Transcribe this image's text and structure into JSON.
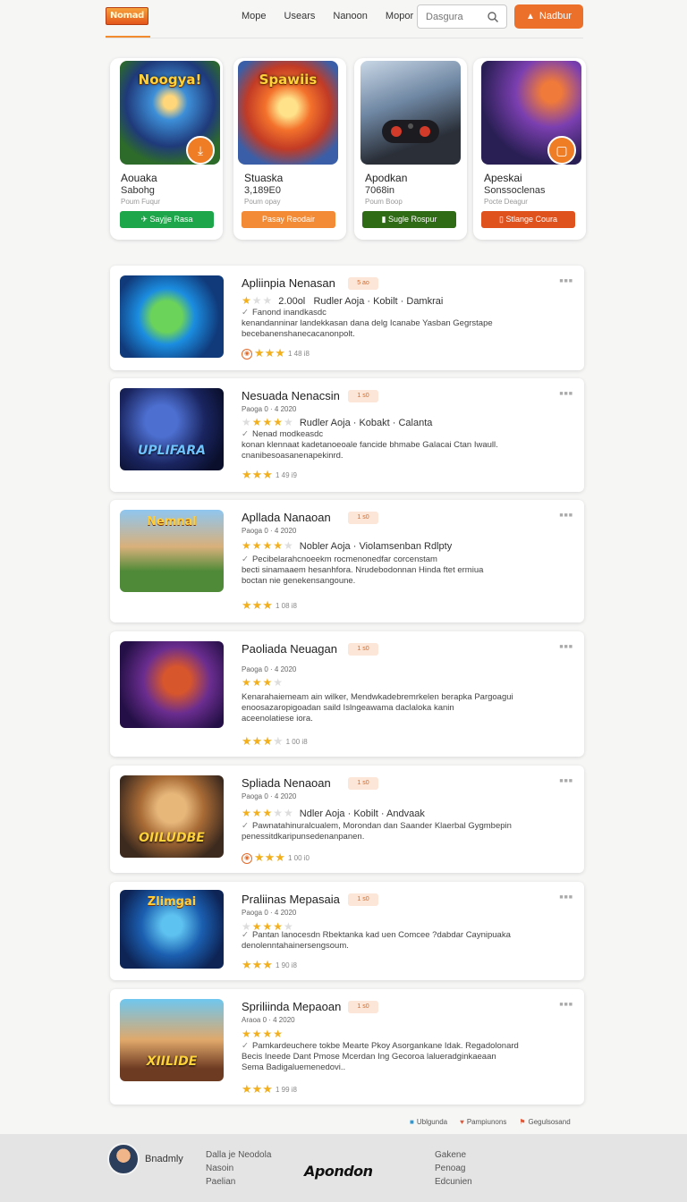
{
  "header": {
    "logo": "Nomad",
    "nav": [
      "Mope",
      "Usears",
      "Nanoon",
      "Mopor"
    ],
    "search_placeholder": "Dasgura",
    "cta_label": "Nadbur"
  },
  "featured": [
    {
      "thumb_text": "Noogya!",
      "title": "Aouaka",
      "subtitle": "Sabohg",
      "caption": "Poum Fuqur",
      "button": "Sayjje Rasa",
      "button_color": "#1ea64a"
    },
    {
      "thumb_text": "Spawiis",
      "title": "Stuaska",
      "subtitle": "3,189E0",
      "caption": "Poum opay",
      "button": "Pasay Reodair",
      "button_color": "#f28a36"
    },
    {
      "thumb_text": "",
      "title": "Apodkan",
      "subtitle": "7068in",
      "caption": "Poum Boop",
      "button": "Sugle Rospur",
      "button_color": "#2f6a14"
    },
    {
      "thumb_text": "",
      "title": "Apeskai",
      "subtitle": "Sonssoclenas",
      "caption": "Pocte Deagur",
      "button": "Stlange Coura",
      "button_color": "#e0521d"
    }
  ],
  "list": [
    {
      "title": "Apliinpia Nenasan",
      "tag": "5 ao",
      "sub": "",
      "meta_prefix": "2.00ol",
      "meta": "Rudler Aoja · Kobilt · Damkrai",
      "desc": [
        "Fanond inandkasdc",
        "kenandanninar landekkasan dana delg Icanabe Yasban Gegrstape",
        "becebanenshanecacanonpolt."
      ],
      "stars": 3,
      "count": "1 48 i8"
    },
    {
      "title": "Nesuada Nenacsin",
      "tag": "1 s0",
      "sub": "Paoga 0 · 4 2020",
      "meta_prefix": "",
      "meta": "Rudler Aoja · Kobakt · Calanta",
      "desc": [
        "Nenad modkeasdc",
        "konan klennaat kadetanoeoale fancide bhmabe Galacai Ctan Iwaull.",
        "cnanibesoasanenapekinrd."
      ],
      "stars": 3,
      "count": "1 49 i9"
    },
    {
      "title": "Apllada Nanaoan",
      "tag": "1 s0",
      "sub": "Paoga 0 · 4 2020",
      "meta_prefix": "",
      "meta": "Nobler Aoja · Violamsenban Rdlpty",
      "desc": [
        "Pecibelarahcnoeekm rocmenonedfar corcenstam",
        "becti sinamaaem hesanhfora. Nrudebodonnan Hinda ftet ermiua",
        "boctan nie genekensangoune."
      ],
      "stars": 3,
      "count": "1 08 i8"
    },
    {
      "title": "Paoliada Neuagan",
      "tag": "1 s0",
      "sub": "Paoga 0 · 4 2020",
      "meta_prefix": "",
      "meta": "",
      "desc": [
        "Kenarahaiemeam ain wilker, Mendwkadebremrkelen berapka Pargoagui",
        "enoosazaropigoadan saild Islngeawama daclaloka kanin",
        "aceenolatiese iora."
      ],
      "stars": 3,
      "count": "1 00 i8"
    },
    {
      "title": "Spliada Nenaoan",
      "tag": "1 s0",
      "sub": "Paoga 0 · 4 2020",
      "meta_prefix": "",
      "meta": "Ndler Aoja · Kobilt · Andvaak",
      "desc": [
        "Pawnatahinuralcualem, Morondan dan Saander Klaerbal Gygmbepin",
        "penessitdkaripunsedenanpanen."
      ],
      "stars": 3,
      "count": "1 00 i0"
    },
    {
      "title": "Praliinas Mepasaia",
      "tag": "1 s0",
      "sub": "Paoga 0 · 4 2020",
      "meta_prefix": "",
      "meta": "",
      "desc": [
        "Pantan lanocesdn Rbektanka kad uen Comcee ?dabdar Caynipuaka",
        "denolenntahainersengsoum."
      ],
      "stars": 3,
      "count": "1 90 i8"
    },
    {
      "title": "Spriliinda Mepaoan",
      "tag": "1 s0",
      "sub": "Araoa 0 · 4 2020",
      "meta_prefix": "",
      "meta": "",
      "desc": [
        "Pamkardeuchere tokbe Mearte Pkoy Asorgankane Idak. Regadolonard",
        "Becis Ineede Dant Pmose Mcerdan Ing Gecoroa lalueradginkaeaan",
        "Sema Badigaluemenedovi.."
      ],
      "stars": 3,
      "count": "1 99 i8"
    }
  ],
  "footer_links": [
    "Ublgunda",
    "Pampiunons",
    "Gegulsosand"
  ],
  "footer": {
    "user": "Bnadmly",
    "col1": [
      "Dalla je Neodola",
      "Nasoin",
      "Paelian"
    ],
    "brand": "Apondon",
    "col2": [
      "Gakene",
      "Penoag",
      "Edcunien"
    ]
  }
}
